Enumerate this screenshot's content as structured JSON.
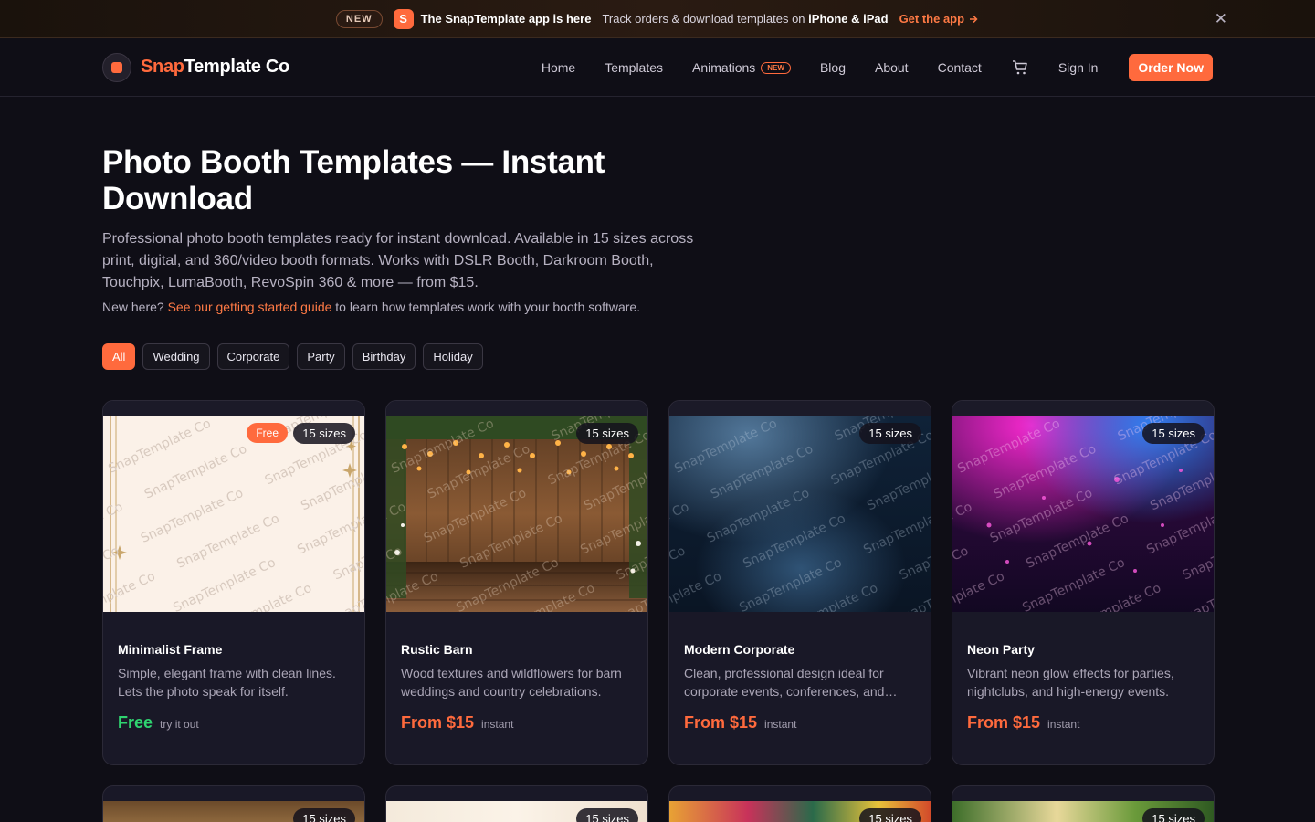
{
  "announcement": {
    "badge": "NEW",
    "app_icon_letter": "S",
    "title": "The SnapTemplate app is here",
    "text_before": "Track orders & download templates on ",
    "text_bold": "iPhone & iPad",
    "link": "Get the app",
    "close_icon": "close-icon"
  },
  "nav": {
    "logo_accent": "Snap",
    "logo_rest": "Template Co",
    "links": [
      "Home",
      "Templates",
      "Animations",
      "Blog",
      "About",
      "Contact"
    ],
    "animations_tag": "NEW",
    "sign_in": "Sign In",
    "order_now": "Order Now",
    "cart_icon": "cart-icon"
  },
  "hero": {
    "title": "Photo Booth Templates — Instant Download",
    "lead": "Professional photo booth templates ready for instant download. Available in 15 sizes across print, digital, and 360/video booth formats. Works with DSLR Booth, Darkroom Booth, Touchpix, LumaBooth, RevoSpin 360 & more — from $15.",
    "guide_before": "New here? ",
    "guide_link": "See our getting started guide",
    "guide_after": " to learn how templates work with your booth software."
  },
  "filters": [
    "All",
    "Wedding",
    "Corporate",
    "Party",
    "Birthday",
    "Holiday"
  ],
  "active_filter": "All",
  "watermark": "SnapTemplate Co",
  "cards": [
    {
      "title": "Minimalist Frame",
      "desc": "Simple, elegant frame with clean lines. Lets the photo speak for itself.",
      "price": "Free",
      "note": "try it out",
      "sizes": "15 sizes",
      "badge": "Free"
    },
    {
      "title": "Rustic Barn",
      "desc": "Wood textures and wildflowers for barn weddings and country celebrations.",
      "price": "From $15",
      "note": "instant",
      "sizes": "15 sizes"
    },
    {
      "title": "Modern Corporate",
      "desc": "Clean, professional design ideal for corporate events, conferences, and…",
      "price": "From $15",
      "note": "instant",
      "sizes": "15 sizes"
    },
    {
      "title": "Neon Party",
      "desc": "Vibrant neon glow effects for parties, nightclubs, and high-energy events.",
      "price": "From $15",
      "note": "instant",
      "sizes": "15 sizes"
    }
  ],
  "cards_row2_sizes": [
    "15 sizes",
    "15 sizes",
    "15 sizes",
    "15 sizes"
  ],
  "colors": {
    "accent": "#ff6a3d",
    "free": "#2fd470",
    "bg": "#0f0e16",
    "card": "#191827"
  }
}
